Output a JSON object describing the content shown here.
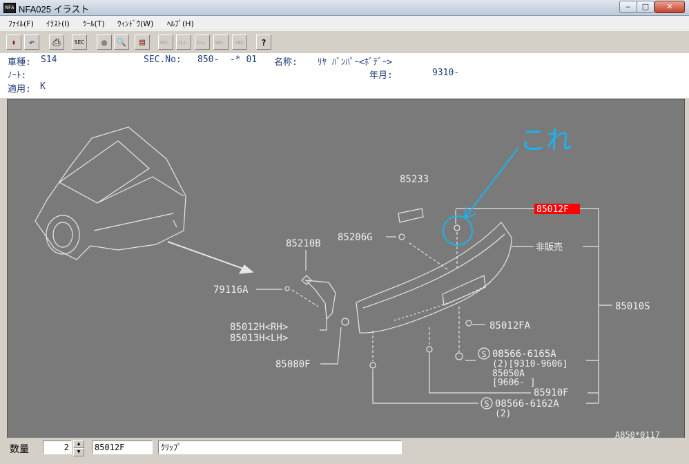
{
  "window": {
    "title": "NFA025 イラスト",
    "app_icon": "NFA",
    "minimize": "‒",
    "maximize": "□",
    "close": "✕"
  },
  "menu": [
    "ﾌｧｲﾙ(F)",
    "ｲﾗｽﾄ(I)",
    "ﾂｰﾙ(T)",
    "ｳｨﾝﾄﾞｳ(W)",
    "ﾍﾙﾌﾟ(H)"
  ],
  "toolbar": {
    "book": "▮",
    "undo": "↶",
    "print": "⎙",
    "sec": "SEC",
    "record": "●",
    "zoom": "🔍",
    "list": "▤",
    "prev_sec": "SEC.",
    "prev_ill": "ILL.",
    "next_ill": "ILL.",
    "next_sec": "SEC.",
    "search_sec": "SEC",
    "help": "?"
  },
  "info": {
    "model_label": "車種:",
    "model_value": "S14",
    "sec_label": "SEC.No:",
    "sec_value": "850-  -* 01",
    "name_label": "名称:",
    "name_value": "ﾘﾔ ﾊﾞﾝﾊﾟｰ<ﾎﾞﾃﾞｰ>",
    "note_label": "ﾉｰﾄ:",
    "date_label": "年月:",
    "date_value": "9310-",
    "apply_label": "適用:",
    "apply_value": "K"
  },
  "diagram": {
    "annotation": "これ",
    "highlighted_part": "85012F",
    "parts": {
      "p85233": "85233",
      "p85206g": "85206G",
      "p85210b": "85210B",
      "p79116a": "79116A",
      "p85012h": "85012H<RH>",
      "p85013h": "85013H<LH>",
      "p85080f": "85080F",
      "p85012fa": "85012FA",
      "hihanbai": "非販売",
      "p85010s": "85010S",
      "p08566_6165a": "08566-6165A",
      "p08566_6165a_note": "(2)[9310-9606]",
      "p85050a": "85050A",
      "p85050a_note": "[9606-    ]",
      "p85910f": "85910F",
      "p08566_6162a": "08566-6162A",
      "p08566_6162a_note": "(2)",
      "s_mark": "S",
      "illus_code": "A850*0117"
    }
  },
  "status": {
    "qty_label": "数量",
    "qty_value": "2",
    "spin_up": "▲",
    "spin_down": "▼",
    "part_no": "85012F",
    "part_name": "ｸﾘｯﾌﾟ"
  }
}
